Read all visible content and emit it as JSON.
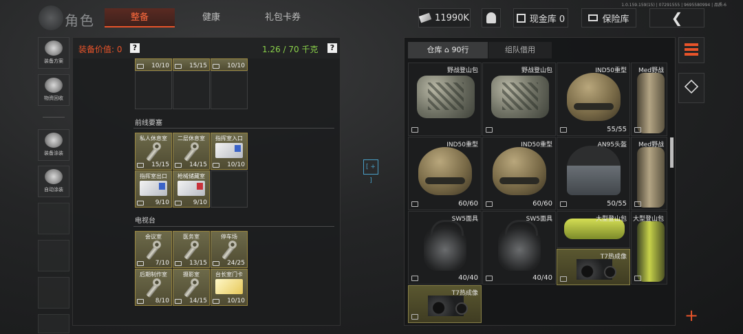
{
  "top": {
    "version": "1.0.159.159(15) | 07291555 | 9695580994 | 品质-6",
    "title": "角色",
    "tabs": [
      {
        "label": "整备"
      },
      {
        "label": "健康"
      },
      {
        "label": "礼包卡券"
      }
    ],
    "currency": "11990K",
    "cash_label": "现金库 0",
    "safe_label": "保险库"
  },
  "sidebar": {
    "items": [
      {
        "label": "装备方案",
        "icon": "loadout-icon"
      },
      {
        "label": "物资回收",
        "icon": "recycle-icon"
      },
      {
        "label": "装备涂装",
        "icon": "paint-icon"
      },
      {
        "label": "自动涂装",
        "icon": "auto-paint-icon"
      }
    ]
  },
  "left": {
    "value_label": "装备价值: 0",
    "help": "?",
    "weight": "1.26 / 70 千克",
    "top_row": [
      {
        "count": "10/10"
      },
      {
        "count": "15/15"
      },
      {
        "count": "10/10"
      }
    ],
    "sections": [
      {
        "title": "前线要塞",
        "items": [
          {
            "name": "私人休息室",
            "count": "15/15",
            "kind": "key"
          },
          {
            "name": "二层休息室",
            "count": "14/15",
            "kind": "key"
          },
          {
            "name": "指挥室入口",
            "count": "10/10",
            "kind": "card"
          },
          {
            "name": "指挥室出口",
            "count": "9/10",
            "kind": "card"
          },
          {
            "name": "枪械储藏室",
            "count": "9/10",
            "kind": "card-red"
          }
        ]
      },
      {
        "title": "电视台",
        "items": [
          {
            "name": "会议室",
            "count": "7/10",
            "kind": "key"
          },
          {
            "name": "医务室",
            "count": "13/15",
            "kind": "key"
          },
          {
            "name": "停车场",
            "count": "24/25",
            "kind": "key"
          },
          {
            "name": "后期制作室",
            "count": "8/10",
            "kind": "key"
          },
          {
            "name": "摄影室",
            "count": "14/15",
            "kind": "key"
          },
          {
            "name": "台长室门卡",
            "count": "10/10",
            "kind": "card-gold"
          }
        ]
      }
    ]
  },
  "right": {
    "tabs": [
      {
        "label": "仓库 ⌂ 90行"
      },
      {
        "label": "组队借用"
      }
    ],
    "cells": [
      {
        "name": "野战登山包",
        "count": "",
        "kind": "bag"
      },
      {
        "name": "野战登山包",
        "count": "",
        "kind": "bag"
      },
      {
        "name": "IND50重型",
        "count": "55/55",
        "kind": "helmet"
      },
      {
        "name": "Med野战",
        "count": "",
        "kind": "tall"
      },
      {
        "name": "IND50重型",
        "count": "60/60",
        "kind": "helmet"
      },
      {
        "name": "IND50重型",
        "count": "60/60",
        "kind": "helmet"
      },
      {
        "name": "AN95头盔",
        "count": "50/55",
        "kind": "shield"
      },
      {
        "name": "Med野战",
        "count": "",
        "kind": "tall"
      },
      {
        "name": "SW5面具",
        "count": "40/40",
        "kind": "mask"
      },
      {
        "name": "SW5面具",
        "count": "40/40",
        "kind": "mask"
      },
      {
        "name": "大型登山包",
        "count": "",
        "kind": "greenbag"
      },
      {
        "name": "大型登山包",
        "count": "",
        "kind": "tallgreen"
      },
      {
        "name": "T7热成像",
        "count": "",
        "kind": "nvg"
      },
      {
        "name": "T7热成像",
        "count": "",
        "kind": "nvg"
      }
    ]
  },
  "colors": {
    "accent": "#e8542a",
    "weight": "#8bd24a",
    "highlight": "#5a5730"
  }
}
